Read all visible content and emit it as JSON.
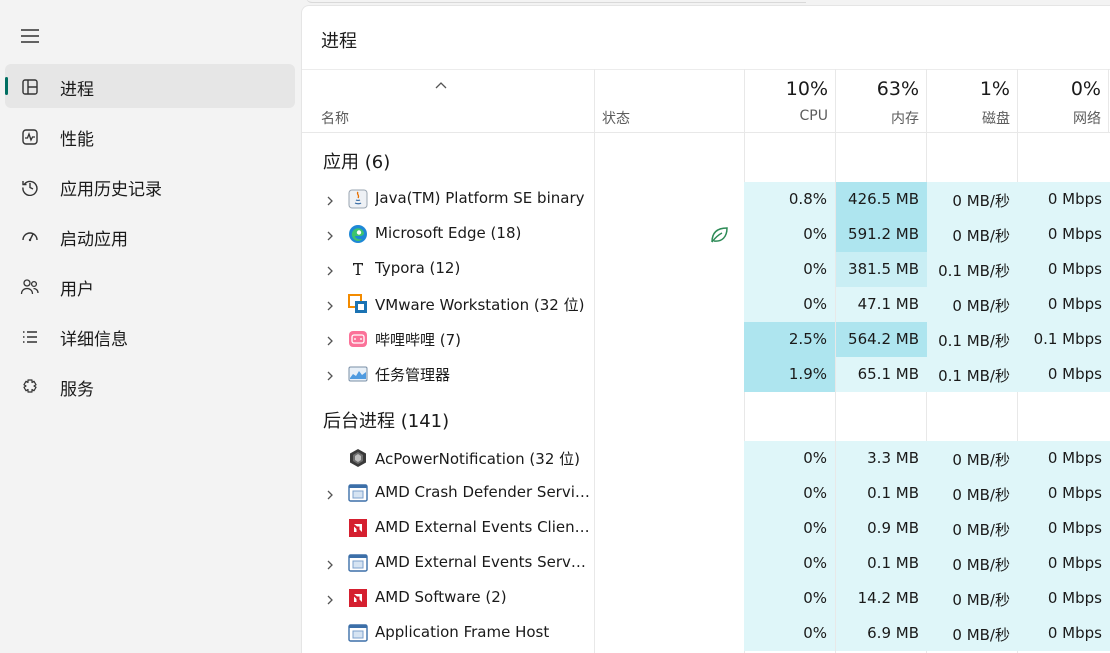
{
  "sidebar": {
    "items": [
      {
        "label": "进程",
        "icon": "processes-icon",
        "active": true
      },
      {
        "label": "性能",
        "icon": "performance-icon",
        "active": false
      },
      {
        "label": "应用历史记录",
        "icon": "app-history-icon",
        "active": false
      },
      {
        "label": "启动应用",
        "icon": "startup-apps-icon",
        "active": false
      },
      {
        "label": "用户",
        "icon": "users-icon",
        "active": false
      },
      {
        "label": "详细信息",
        "icon": "details-icon",
        "active": false
      },
      {
        "label": "服务",
        "icon": "services-icon",
        "active": false
      }
    ]
  },
  "page": {
    "title": "进程"
  },
  "columns": {
    "name": "名称",
    "status": "状态",
    "cpu": {
      "label": "CPU",
      "pct": "10%"
    },
    "memory": {
      "label": "内存",
      "pct": "63%"
    },
    "disk": {
      "label": "磁盘",
      "pct": "1%"
    },
    "network": {
      "label": "网络",
      "pct": "0%"
    }
  },
  "groups": {
    "apps": {
      "title": "应用 (6)",
      "rows": [
        {
          "name": "Java(TM) Platform SE binary",
          "icon": "java-icon",
          "expandable": true,
          "cpu": "0.8%",
          "mem": "426.5 MB",
          "disk": "0 MB/秒",
          "net": "0 Mbps",
          "cpu_level": "light",
          "mem_level": "deep"
        },
        {
          "name": "Microsoft Edge (18)",
          "icon": "edge-icon",
          "expandable": true,
          "status": "efficiency-mode-leaf-icon",
          "cpu": "0%",
          "mem": "591.2 MB",
          "disk": "0 MB/秒",
          "net": "0 Mbps",
          "cpu_level": "light",
          "mem_level": "deep"
        },
        {
          "name": "Typora (12)",
          "icon": "typora-icon",
          "expandable": true,
          "cpu": "0%",
          "mem": "381.5 MB",
          "disk": "0.1 MB/秒",
          "net": "0 Mbps",
          "cpu_level": "light",
          "mem_level": "mid"
        },
        {
          "name": "VMware Workstation (32 位)",
          "icon": "vmware-icon",
          "expandable": true,
          "cpu": "0%",
          "mem": "47.1 MB",
          "disk": "0 MB/秒",
          "net": "0 Mbps",
          "cpu_level": "light",
          "mem_level": "light"
        },
        {
          "name": "哔哩哔哩 (7)",
          "icon": "bilibili-icon",
          "expandable": true,
          "cpu": "2.5%",
          "mem": "564.2 MB",
          "disk": "0.1 MB/秒",
          "net": "0.1 Mbps",
          "cpu_level": "deep",
          "mem_level": "deep"
        },
        {
          "name": "任务管理器",
          "icon": "task-manager-icon",
          "expandable": true,
          "cpu": "1.9%",
          "mem": "65.1 MB",
          "disk": "0.1 MB/秒",
          "net": "0 Mbps",
          "cpu_level": "deep",
          "mem_level": "light"
        }
      ]
    },
    "background": {
      "title": "后台进程 (141)",
      "rows": [
        {
          "name": "AcPowerNotification (32 位)",
          "icon": "acpower-icon",
          "expandable": false,
          "cpu": "0%",
          "mem": "3.3 MB",
          "disk": "0 MB/秒",
          "net": "0 Mbps",
          "cpu_level": "light",
          "mem_level": "light"
        },
        {
          "name": "AMD Crash Defender Service",
          "icon": "service-window-icon",
          "expandable": true,
          "cpu": "0%",
          "mem": "0.1 MB",
          "disk": "0 MB/秒",
          "net": "0 Mbps",
          "cpu_level": "light",
          "mem_level": "light"
        },
        {
          "name": "AMD External Events Client Module",
          "icon": "amd-icon",
          "expandable": false,
          "cpu": "0%",
          "mem": "0.9 MB",
          "disk": "0 MB/秒",
          "net": "0 Mbps",
          "cpu_level": "light",
          "mem_level": "light"
        },
        {
          "name": "AMD External Events Service Module",
          "icon": "service-window-icon",
          "expandable": true,
          "cpu": "0%",
          "mem": "0.1 MB",
          "disk": "0 MB/秒",
          "net": "0 Mbps",
          "cpu_level": "light",
          "mem_level": "light"
        },
        {
          "name": "AMD Software (2)",
          "icon": "amd-icon",
          "expandable": true,
          "cpu": "0%",
          "mem": "14.2 MB",
          "disk": "0 MB/秒",
          "net": "0 Mbps",
          "cpu_level": "light",
          "mem_level": "light"
        },
        {
          "name": "Application Frame Host",
          "icon": "service-window-icon",
          "expandable": false,
          "cpu": "0%",
          "mem": "6.9 MB",
          "disk": "0 MB/秒",
          "net": "0 Mbps",
          "cpu_level": "light",
          "mem_level": "light"
        }
      ]
    }
  },
  "colors": {
    "accent": "#006f62",
    "heat_light": "#dff6f9",
    "heat_mid": "#c9eef4",
    "heat_deep": "#aee5ef"
  }
}
